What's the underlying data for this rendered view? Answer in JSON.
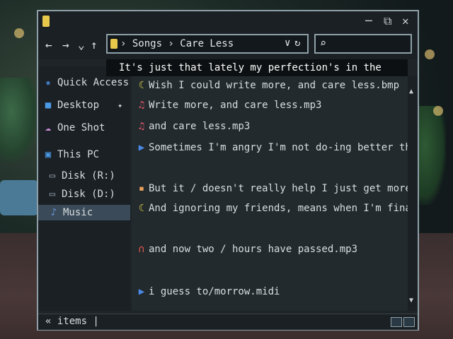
{
  "window": {
    "controls": {
      "minimize": "─",
      "maximize": "⧉",
      "close": "✕"
    }
  },
  "toolbar": {
    "back": "←",
    "forward": "→",
    "recent": "⌄",
    "up": "↑",
    "address_path": "› Songs › Care Less",
    "address_dropdown": "∨",
    "address_refresh": "↻",
    "search_icon": "⌕",
    "search_value": ""
  },
  "caption": "It's just that lately my perfection's in the",
  "sidebar": {
    "items": [
      {
        "label": "Quick Access",
        "icon": "pin-icon",
        "glyph": "★",
        "color": "#4a8ad8"
      },
      {
        "label": "Desktop",
        "icon": "desktop-icon",
        "glyph": "■",
        "color": "#4a9ae8"
      },
      {
        "label": "One Shot",
        "icon": "cloud-icon",
        "glyph": "☁",
        "color": "#c88ad8"
      },
      {
        "label": "This PC",
        "icon": "computer-icon",
        "glyph": "▣",
        "color": "#4a9ae8"
      },
      {
        "label": "Disk (R:)",
        "icon": "disk-icon",
        "glyph": "▭",
        "color": "#9aa8b0"
      },
      {
        "label": "Disk (D:)",
        "icon": "disk-icon",
        "glyph": "▭",
        "color": "#9aa8b0"
      },
      {
        "label": "Music",
        "icon": "music-note-icon",
        "glyph": "♪",
        "color": "#6a9ae8"
      }
    ]
  },
  "files": [
    {
      "name": "Wish I could write more, and care less.bmp",
      "icon": "moon-icon",
      "glyph": "☾",
      "color": "#e8d84a"
    },
    {
      "name": "Write more, and care less.mp3",
      "icon": "audio-icon",
      "glyph": "♫",
      "color": "#e85a6a"
    },
    {
      "name": "and care less.mp3",
      "icon": "audio-icon",
      "glyph": "♫",
      "color": "#e85a6a"
    },
    {
      "name": "Sometimes I'm angry I'm not do-ing better than",
      "icon": "play-icon",
      "glyph": "▶",
      "color": "#4a8ae8"
    },
    {
      "name": "But it / doesn't really help I just get more de",
      "icon": "image-icon",
      "glyph": "▪",
      "color": "#e8a05a"
    },
    {
      "name": "And ignoring my friends, means when I'm finally",
      "icon": "moon-icon",
      "glyph": "☾",
      "color": "#e8d84a"
    },
    {
      "name": "and now two / hours have passed.mp3",
      "icon": "headphones-icon",
      "glyph": "∩",
      "color": "#e85a4a"
    },
    {
      "name": "i guess to/morrow.midi",
      "icon": "play-icon",
      "glyph": "▶",
      "color": "#4a8ae8"
    }
  ],
  "statusbar": {
    "text": "« items |"
  }
}
